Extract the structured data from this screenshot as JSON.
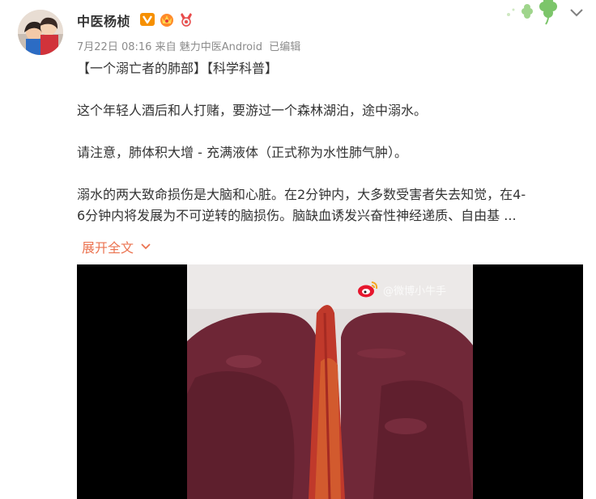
{
  "post": {
    "author": "中医杨桢",
    "timestamp": "7月22日 08:16",
    "source_prefix": "来自",
    "source": "魅力中医Android",
    "edited": "已编辑",
    "tags": "【一个溺亡者的肺部】【科学科普】",
    "paragraph1": "这个年轻人酒后和人打赌，要游过一个森林湖泊，途中溺水。",
    "paragraph2": "请注意，肺体积大增 - 充满液体（正式称为水性肺气肿）。",
    "paragraph3_line1": "溺水的两大致命损伤是大脑和心脏。在2分钟内，大多数受害者失去知觉，在4-",
    "paragraph3_line2": "6分钟内将发展为不可逆转的脑损伤。脑缺血诱发兴奋性神经递质、自由基 ...",
    "expand_label": "展开全文",
    "badges": [
      "verified-v-icon",
      "crown-badge-icon",
      "medal-badge-icon"
    ]
  },
  "media": {
    "watermark_text": "@微博小牛手"
  },
  "colors": {
    "link": "#eb7350",
    "meta": "#8c8c8c",
    "verified": "#f69001",
    "lung": "#7a2b3b"
  }
}
